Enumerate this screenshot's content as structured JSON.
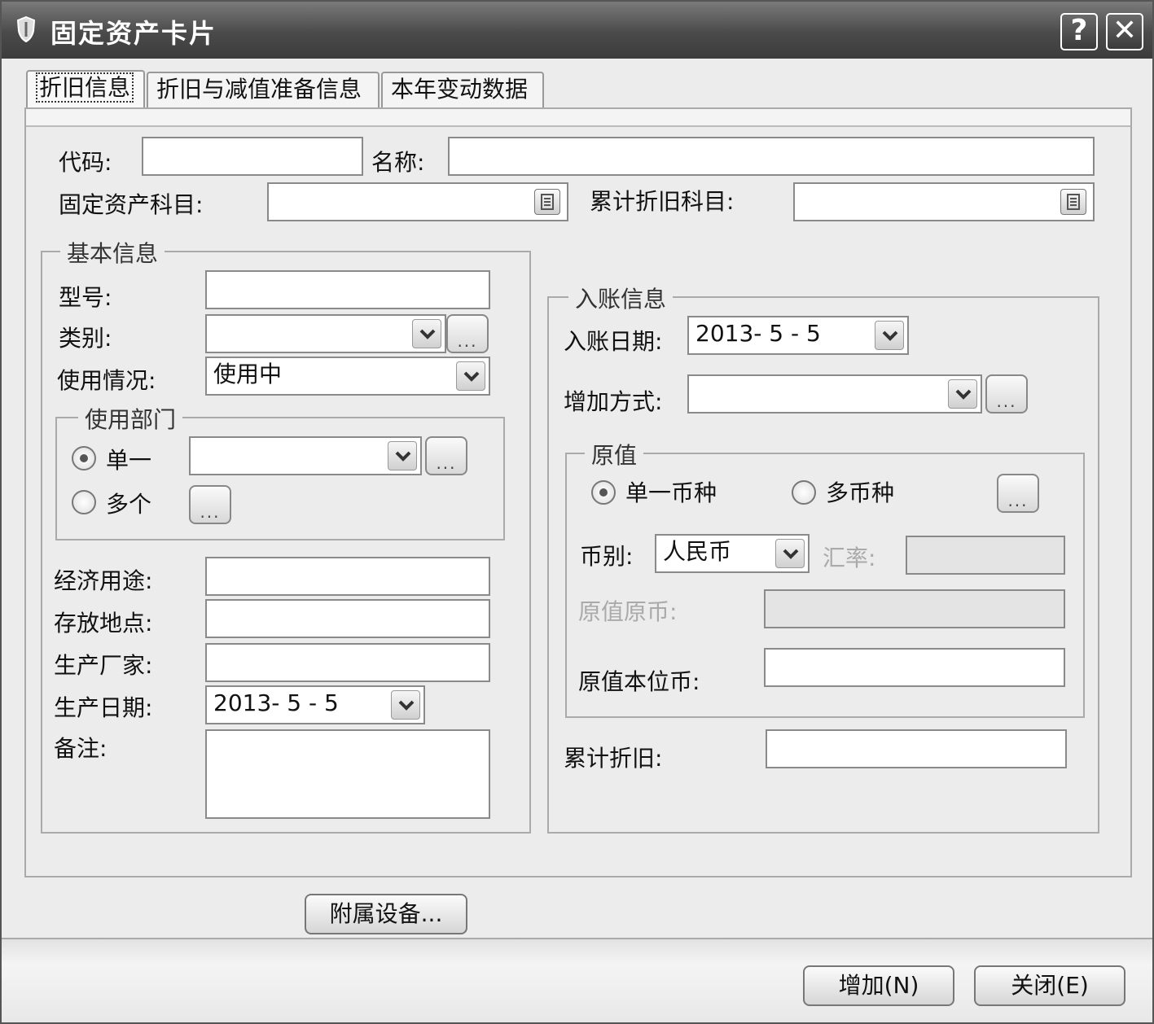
{
  "window": {
    "title": "固定资产卡片",
    "help_btn": "?",
    "close_btn": "✕"
  },
  "tabs": [
    {
      "label": "折旧信息"
    },
    {
      "label": "折旧与减值准备信息"
    },
    {
      "label": "本年变动数据"
    }
  ],
  "header": {
    "code_label": "代码:",
    "code_value": "",
    "name_label": "名称:",
    "name_value": "",
    "asset_account_label": "固定资产科目:",
    "asset_account_value": "",
    "accum_dep_account_label": "累计折旧科目:",
    "accum_dep_account_value": ""
  },
  "basic": {
    "title": "基本信息",
    "model_label": "型号:",
    "model_value": "",
    "category_label": "类别:",
    "category_value": "",
    "usage_label": "使用情况:",
    "usage_value": "使用中",
    "dept": {
      "title": "使用部门",
      "single_label": "单一",
      "multi_label": "多个",
      "single_value": "",
      "selected": "single"
    },
    "purpose_label": "经济用途:",
    "purpose_value": "",
    "location_label": "存放地点:",
    "location_value": "",
    "maker_label": "生产厂家:",
    "maker_value": "",
    "prod_date_label": "生产日期:",
    "prod_date_value": "2013- 5 - 5",
    "note_label": "备注:",
    "note_value": ""
  },
  "entry": {
    "title": "入账信息",
    "date_label": "入账日期:",
    "date_value": "2013- 5 - 5",
    "method_label": "增加方式:",
    "method_value": "",
    "orig": {
      "title": "原值",
      "single_currency_label": "单一币种",
      "multi_currency_label": "多币种",
      "selected": "single",
      "currency_label": "币别:",
      "currency_value": "人民币",
      "rate_label": "汇率:",
      "rate_value": "",
      "orig_fc_label": "原值原币:",
      "orig_fc_value": "",
      "orig_base_label": "原值本位币:",
      "orig_base_value": ""
    },
    "accum_dep_label": "累计折旧:",
    "accum_dep_value": ""
  },
  "buttons": {
    "ellipsis": "...",
    "accessory": "附属设备...",
    "add": "增加(N)",
    "close": "关闭(E)"
  },
  "colors": {
    "titlebar": "#4a4a4a",
    "panel": "#ececec",
    "disabled_text": "#aaaaaa"
  }
}
